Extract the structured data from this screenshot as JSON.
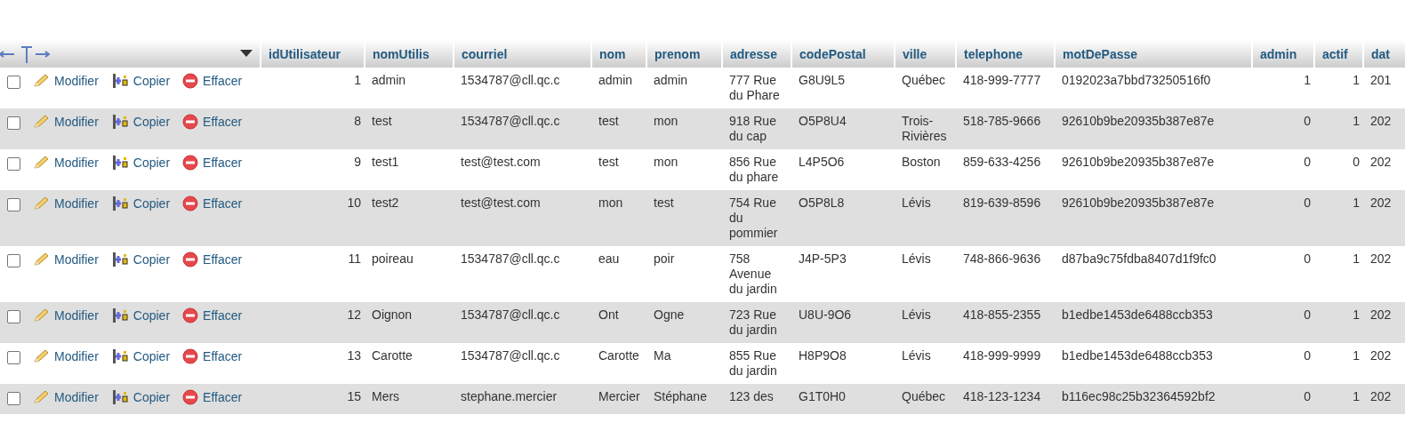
{
  "table": {
    "columns": [
      {
        "label": "idUtilisateur",
        "kind": "number"
      },
      {
        "label": "nomUtilis",
        "kind": "text"
      },
      {
        "label": "courriel",
        "kind": "text"
      },
      {
        "label": "nom",
        "kind": "text"
      },
      {
        "label": "prenom",
        "kind": "text"
      },
      {
        "label": "adresse",
        "kind": "long"
      },
      {
        "label": "codePostal",
        "kind": "text"
      },
      {
        "label": "ville",
        "kind": "long"
      },
      {
        "label": "telephone",
        "kind": "text"
      },
      {
        "label": "motDePasse",
        "kind": "text"
      },
      {
        "label": "admin",
        "kind": "number"
      },
      {
        "label": "actif",
        "kind": "number"
      },
      {
        "label": "dat",
        "kind": "text"
      }
    ],
    "rows": [
      {
        "checked": false,
        "actions": [
          {
            "kind": "edit",
            "label": "Modifier"
          },
          {
            "kind": "copy",
            "label": "Copier"
          },
          {
            "kind": "delete",
            "label": "Effacer"
          }
        ],
        "cells": [
          "1",
          "admin",
          "1534787@cll.qc.c",
          "admin",
          "admin",
          "777 Rue du Phare",
          "G8U9L5",
          "Québec",
          "418-999-7777",
          "0192023a7bbd73250516f0",
          "1",
          "1",
          "201"
        ]
      },
      {
        "checked": false,
        "actions": [
          {
            "kind": "edit",
            "label": "Modifier"
          },
          {
            "kind": "copy",
            "label": "Copier"
          },
          {
            "kind": "delete",
            "label": "Effacer"
          }
        ],
        "cells": [
          "8",
          "test",
          "1534787@cll.qc.c",
          "test",
          "mon",
          "918 Rue du cap",
          "O5P8U4",
          "Trois-Rivières",
          "518-785-9666",
          "92610b9be20935b387e87e",
          "0",
          "1",
          "202"
        ]
      },
      {
        "checked": false,
        "actions": [
          {
            "kind": "edit",
            "label": "Modifier"
          },
          {
            "kind": "copy",
            "label": "Copier"
          },
          {
            "kind": "delete",
            "label": "Effacer"
          }
        ],
        "cells": [
          "9",
          "test1",
          "test@test.com",
          "test",
          "mon",
          "856 Rue du phare",
          "L4P5O6",
          "Boston",
          "859-633-4256",
          "92610b9be20935b387e87e",
          "0",
          "0",
          "202"
        ]
      },
      {
        "checked": false,
        "actions": [
          {
            "kind": "edit",
            "label": "Modifier"
          },
          {
            "kind": "copy",
            "label": "Copier"
          },
          {
            "kind": "delete",
            "label": "Effacer"
          }
        ],
        "cells": [
          "10",
          "test2",
          "test@test.com",
          "mon",
          "test",
          "754 Rue du pommier",
          "O5P8L8",
          "Lévis",
          "819-639-8596",
          "92610b9be20935b387e87e",
          "0",
          "1",
          "202"
        ]
      },
      {
        "checked": false,
        "actions": [
          {
            "kind": "edit",
            "label": "Modifier"
          },
          {
            "kind": "copy",
            "label": "Copier"
          },
          {
            "kind": "delete",
            "label": "Effacer"
          }
        ],
        "cells": [
          "11",
          "poireau",
          "1534787@cll.qc.c",
          "eau",
          "poir",
          "758 Avenue du jardin",
          "J4P-5P3",
          "Lévis",
          "748-866-9636",
          "d87ba9c75fdba8407d1f9fc0",
          "0",
          "1",
          "202"
        ]
      },
      {
        "checked": false,
        "actions": [
          {
            "kind": "edit",
            "label": "Modifier"
          },
          {
            "kind": "copy",
            "label": "Copier"
          },
          {
            "kind": "delete",
            "label": "Effacer"
          }
        ],
        "cells": [
          "12",
          "Oignon",
          "1534787@cll.qc.c",
          "Ont",
          "Ogne",
          "723 Rue du jardin",
          "U8U-9O6",
          "Lévis",
          "418-855-2355",
          "b1edbe1453de6488ccb353",
          "0",
          "1",
          "202"
        ]
      },
      {
        "checked": false,
        "actions": [
          {
            "kind": "edit",
            "label": "Modifier"
          },
          {
            "kind": "copy",
            "label": "Copier"
          },
          {
            "kind": "delete",
            "label": "Effacer"
          }
        ],
        "cells": [
          "13",
          "Carotte",
          "1534787@cll.qc.c",
          "Carotte",
          "Ma",
          "855 Rue du jardin",
          "H8P9O8",
          "Lévis",
          "418-999-9999",
          "b1edbe1453de6488ccb353",
          "0",
          "1",
          "202"
        ]
      },
      {
        "checked": false,
        "actions": [
          {
            "kind": "edit",
            "label": "Modifier"
          },
          {
            "kind": "copy",
            "label": "Copier"
          },
          {
            "kind": "delete",
            "label": "Effacer"
          }
        ],
        "cells": [
          "15",
          "Mers",
          "stephane.mercier",
          "Mercier",
          "Stéphane",
          "123 des",
          "G1T0H0",
          "Québec",
          "418-123-1234",
          "b116ec98c25b32364592bf2",
          "0",
          "1",
          "202"
        ]
      }
    ]
  }
}
